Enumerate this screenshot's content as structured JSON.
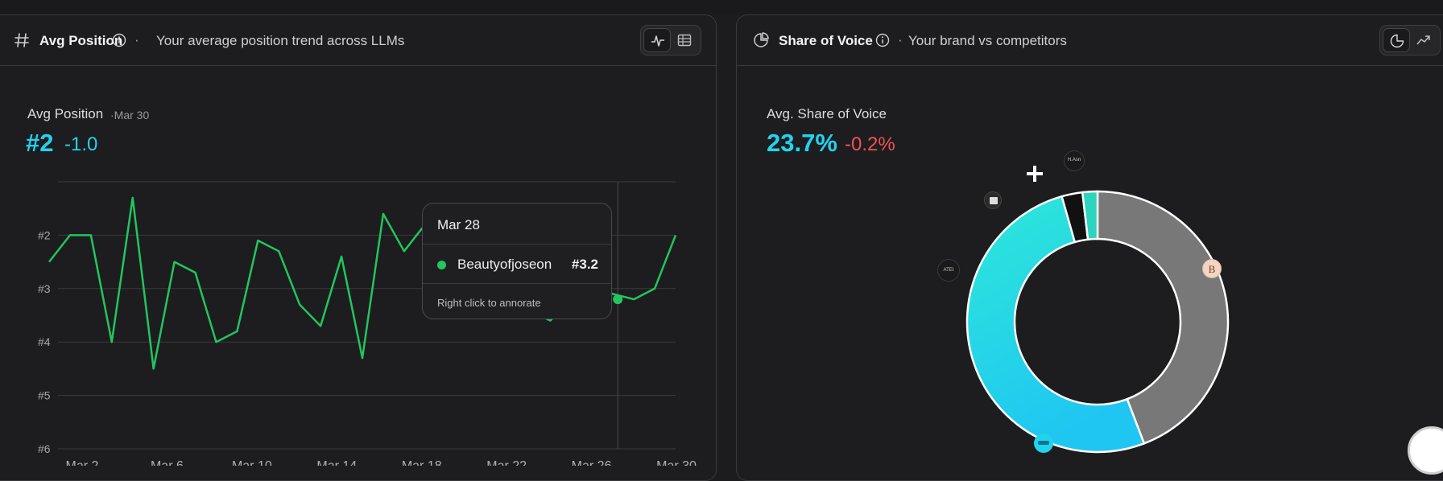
{
  "left_panel": {
    "title": "Avg Position",
    "separator": "·",
    "subtitle": "Your average position trend across LLMs",
    "icon": "hash-icon",
    "view_toggle": [
      "line-chart-icon",
      "table-icon"
    ],
    "metric": {
      "label": "Avg Position",
      "date": "·Mar 30",
      "value": "#2",
      "delta": "-1.0"
    },
    "tooltip": {
      "date": "Mar 28",
      "series_name": "Beautyofjoseon",
      "value": "#3.2",
      "hint": "Right click to annorate"
    }
  },
  "right_panel": {
    "title": "Share of Voice",
    "separator": "·",
    "subtitle": "Your brand vs competitors",
    "icon": "pie-chart-icon",
    "view_toggle": [
      "pie-chart-icon",
      "trend-icon"
    ],
    "metric": {
      "label": "Avg. Share of Voice",
      "value": "23.7%",
      "delta": "-0.2%"
    },
    "donut_labels": [
      "ATEI",
      "H.Asn",
      "B"
    ]
  },
  "colors": {
    "accent_cyan": "#22d3ee",
    "line_green": "#22c55e",
    "negative_red": "#f05252",
    "donut_grey": "#787878"
  },
  "chart_data": [
    {
      "type": "line",
      "x_ticks": [
        "Mar 2",
        "Mar 6",
        "Mar 10",
        "Mar 14",
        "Mar 18",
        "Mar 22",
        "Mar 26",
        "Mar 30"
      ],
      "y_ticks": [
        "#2",
        "#3",
        "#4",
        "#5",
        "#6"
      ],
      "ylim": [
        1,
        6
      ],
      "y_inverted": true,
      "grid": true,
      "series": [
        {
          "name": "Beautyofjoseon",
          "values": [
            2.5,
            2.0,
            2.0,
            4.0,
            1.3,
            4.5,
            2.5,
            2.7,
            4.0,
            3.8,
            2.1,
            2.3,
            3.3,
            3.7,
            2.4,
            4.3,
            1.6,
            2.3,
            1.8,
            2.0,
            2.2,
            2.6,
            3.0,
            3.4,
            3.6,
            3.2,
            3.0,
            3.1,
            3.2,
            3.0,
            2.0
          ]
        }
      ],
      "highlight": {
        "x": "Mar 28",
        "value": 3.2
      }
    },
    {
      "type": "pie",
      "donut": true,
      "slices": [
        {
          "value": 43.0,
          "color": "#787878"
        },
        {
          "value": 50.0,
          "color": "#22d3ee"
        },
        {
          "value": 2.5,
          "color": "#111111"
        },
        {
          "value": 1.8,
          "color": "#2dd4bf"
        }
      ]
    }
  ]
}
